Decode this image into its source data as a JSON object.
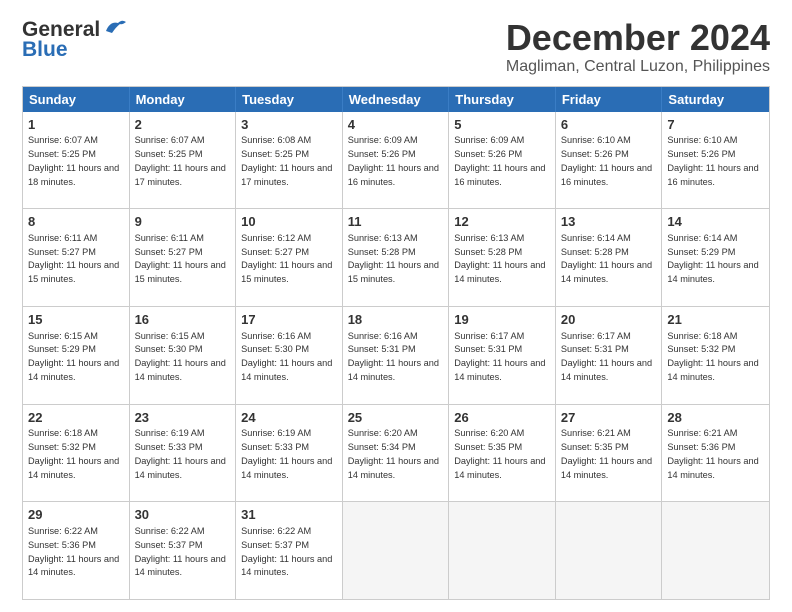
{
  "header": {
    "logo_general": "General",
    "logo_blue": "Blue",
    "title": "December 2024",
    "subtitle": "Magliman, Central Luzon, Philippines"
  },
  "calendar": {
    "days_of_week": [
      "Sunday",
      "Monday",
      "Tuesday",
      "Wednesday",
      "Thursday",
      "Friday",
      "Saturday"
    ],
    "weeks": [
      [
        {
          "day": "",
          "empty": true
        },
        {
          "day": "",
          "empty": true
        },
        {
          "day": "",
          "empty": true
        },
        {
          "day": "",
          "empty": true
        },
        {
          "day": "",
          "empty": true
        },
        {
          "day": "",
          "empty": true
        },
        {
          "day": "",
          "empty": true
        }
      ]
    ],
    "cells": [
      {
        "day": "1",
        "sunrise": "6:07 AM",
        "sunset": "5:25 PM",
        "daylight": "11 hours and 18 minutes."
      },
      {
        "day": "2",
        "sunrise": "6:07 AM",
        "sunset": "5:25 PM",
        "daylight": "11 hours and 17 minutes."
      },
      {
        "day": "3",
        "sunrise": "6:08 AM",
        "sunset": "5:25 PM",
        "daylight": "11 hours and 17 minutes."
      },
      {
        "day": "4",
        "sunrise": "6:09 AM",
        "sunset": "5:26 PM",
        "daylight": "11 hours and 16 minutes."
      },
      {
        "day": "5",
        "sunrise": "6:09 AM",
        "sunset": "5:26 PM",
        "daylight": "11 hours and 16 minutes."
      },
      {
        "day": "6",
        "sunrise": "6:10 AM",
        "sunset": "5:26 PM",
        "daylight": "11 hours and 16 minutes."
      },
      {
        "day": "7",
        "sunrise": "6:10 AM",
        "sunset": "5:26 PM",
        "daylight": "11 hours and 16 minutes."
      },
      {
        "day": "8",
        "sunrise": "6:11 AM",
        "sunset": "5:27 PM",
        "daylight": "11 hours and 15 minutes."
      },
      {
        "day": "9",
        "sunrise": "6:11 AM",
        "sunset": "5:27 PM",
        "daylight": "11 hours and 15 minutes."
      },
      {
        "day": "10",
        "sunrise": "6:12 AM",
        "sunset": "5:27 PM",
        "daylight": "11 hours and 15 minutes."
      },
      {
        "day": "11",
        "sunrise": "6:13 AM",
        "sunset": "5:28 PM",
        "daylight": "11 hours and 15 minutes."
      },
      {
        "day": "12",
        "sunrise": "6:13 AM",
        "sunset": "5:28 PM",
        "daylight": "11 hours and 14 minutes."
      },
      {
        "day": "13",
        "sunrise": "6:14 AM",
        "sunset": "5:28 PM",
        "daylight": "11 hours and 14 minutes."
      },
      {
        "day": "14",
        "sunrise": "6:14 AM",
        "sunset": "5:29 PM",
        "daylight": "11 hours and 14 minutes."
      },
      {
        "day": "15",
        "sunrise": "6:15 AM",
        "sunset": "5:29 PM",
        "daylight": "11 hours and 14 minutes."
      },
      {
        "day": "16",
        "sunrise": "6:15 AM",
        "sunset": "5:30 PM",
        "daylight": "11 hours and 14 minutes."
      },
      {
        "day": "17",
        "sunrise": "6:16 AM",
        "sunset": "5:30 PM",
        "daylight": "11 hours and 14 minutes."
      },
      {
        "day": "18",
        "sunrise": "6:16 AM",
        "sunset": "5:31 PM",
        "daylight": "11 hours and 14 minutes."
      },
      {
        "day": "19",
        "sunrise": "6:17 AM",
        "sunset": "5:31 PM",
        "daylight": "11 hours and 14 minutes."
      },
      {
        "day": "20",
        "sunrise": "6:17 AM",
        "sunset": "5:31 PM",
        "daylight": "11 hours and 14 minutes."
      },
      {
        "day": "21",
        "sunrise": "6:18 AM",
        "sunset": "5:32 PM",
        "daylight": "11 hours and 14 minutes."
      },
      {
        "day": "22",
        "sunrise": "6:18 AM",
        "sunset": "5:32 PM",
        "daylight": "11 hours and 14 minutes."
      },
      {
        "day": "23",
        "sunrise": "6:19 AM",
        "sunset": "5:33 PM",
        "daylight": "11 hours and 14 minutes."
      },
      {
        "day": "24",
        "sunrise": "6:19 AM",
        "sunset": "5:33 PM",
        "daylight": "11 hours and 14 minutes."
      },
      {
        "day": "25",
        "sunrise": "6:20 AM",
        "sunset": "5:34 PM",
        "daylight": "11 hours and 14 minutes."
      },
      {
        "day": "26",
        "sunrise": "6:20 AM",
        "sunset": "5:35 PM",
        "daylight": "11 hours and 14 minutes."
      },
      {
        "day": "27",
        "sunrise": "6:21 AM",
        "sunset": "5:35 PM",
        "daylight": "11 hours and 14 minutes."
      },
      {
        "day": "28",
        "sunrise": "6:21 AM",
        "sunset": "5:36 PM",
        "daylight": "11 hours and 14 minutes."
      },
      {
        "day": "29",
        "sunrise": "6:22 AM",
        "sunset": "5:36 PM",
        "daylight": "11 hours and 14 minutes."
      },
      {
        "day": "30",
        "sunrise": "6:22 AM",
        "sunset": "5:37 PM",
        "daylight": "11 hours and 14 minutes."
      },
      {
        "day": "31",
        "sunrise": "6:22 AM",
        "sunset": "5:37 PM",
        "daylight": "11 hours and 14 minutes."
      }
    ]
  }
}
